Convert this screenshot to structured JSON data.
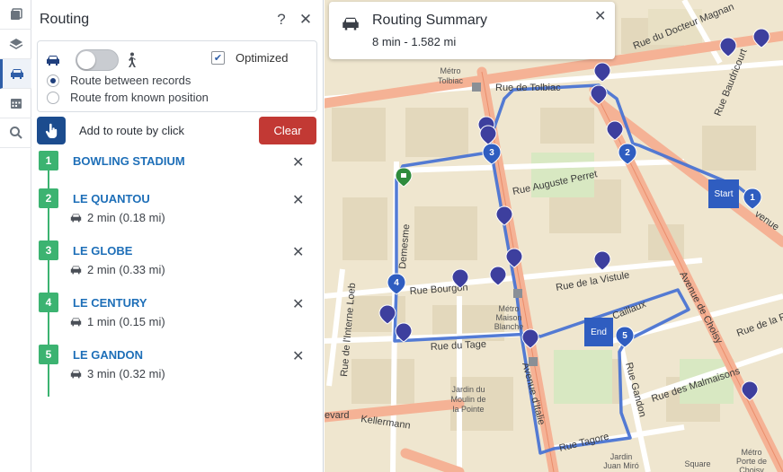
{
  "toolbar": {
    "items": [
      {
        "icon": "layers-stack-icon"
      },
      {
        "icon": "layers-icon"
      },
      {
        "icon": "car-icon",
        "active": true
      },
      {
        "icon": "calendar-icon"
      },
      {
        "icon": "search-icon"
      }
    ]
  },
  "panel": {
    "title": "Routing",
    "help": "?",
    "close": "✕",
    "optimized_label": "Optimized",
    "optimized_checked": true,
    "route_between_label": "Route between records",
    "route_known_label": "Route from known position",
    "add_by_click_label": "Add to route by click",
    "clear_label": "Clear",
    "stops": [
      {
        "num": "1",
        "name": "BOWLING STADIUM",
        "leg": ""
      },
      {
        "num": "2",
        "name": "LE QUANTOU",
        "leg": "2 min (0.18 mi)"
      },
      {
        "num": "3",
        "name": "LE GLOBE",
        "leg": "2 min (0.33 mi)"
      },
      {
        "num": "4",
        "name": "LE CENTURY",
        "leg": "1 min (0.15 mi)"
      },
      {
        "num": "5",
        "name": "LE GANDON",
        "leg": "3 min (0.32 mi)"
      }
    ]
  },
  "summary": {
    "title": "Routing Summary",
    "subtitle": "8 min - 1.582 mi",
    "close": "✕"
  },
  "map": {
    "start_label": "Start",
    "end_label": "End",
    "streets": {
      "tolbiac": "Rue de Tolbiac",
      "perret": "Rue Auguste Perret",
      "bourgon": "Rue Bourgon",
      "vistule": "Rue de la Vistule",
      "tage": "Rue du Tage",
      "choisy": "Avenue de Choisy",
      "italie": "Avenue d'Italie",
      "kellermann": "Kellermann",
      "baudricourt": "Rue Baudricourt",
      "tagore": "Rue Tagore",
      "malmaisons": "Rue des Malmaisons",
      "gandon": "Rue Gandon",
      "demesme": "Demesme",
      "interneloeb": "Rue de l'Interne Loeb",
      "magnan": "Rue du Docteur Magnan",
      "pole": "Rue de la Po",
      "evard": "evard",
      "caillaux": "Caillaux",
      "venue": "venue"
    },
    "places": {
      "tolbiac_metro": "Métro\nTolbiac",
      "maison_blanche": "Métro\nMaison\nBlanche",
      "jardin": "Jardin du\nMoulin de\nla Pointe",
      "square": "Square",
      "porte_choisy": "Métro\nPorte de\nChoisy",
      "jardin2": "Jardin\nJuan Miró"
    },
    "colors": {
      "route": "#4a74d3",
      "marker": "#3d3f9e",
      "marker_start": "#2e8b3c",
      "avenue": "#f2a98d",
      "street": "#ffffff",
      "block": "#efe6cf",
      "park": "#cfe6b4"
    }
  }
}
